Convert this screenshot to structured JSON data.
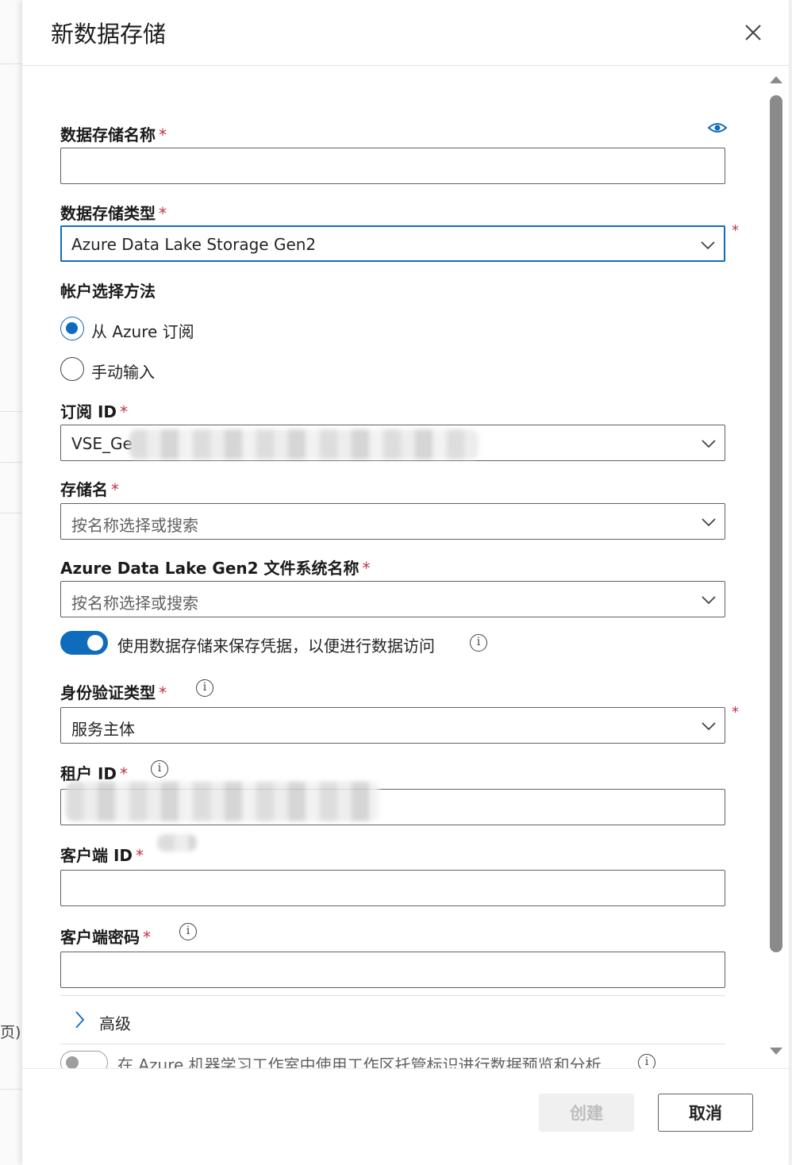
{
  "background": {
    "cut_text": "页)"
  },
  "panel": {
    "title": "新数据存储"
  },
  "form": {
    "datastore_name": {
      "label": "数据存储名称",
      "required": "*",
      "value": ""
    },
    "datastore_type": {
      "label": "数据存储类型",
      "required": "*",
      "value": "Azure Data Lake Storage Gen2",
      "outer_required": "*"
    },
    "account_method": {
      "label": "帐户选择方法",
      "options": [
        {
          "label": "从 Azure 订阅",
          "selected": true
        },
        {
          "label": "手动输入",
          "selected": false
        }
      ]
    },
    "subscription_id": {
      "label": "订阅 ID",
      "required": "*",
      "value": "VSE_Ge"
    },
    "storage_name": {
      "label": "存储名",
      "required": "*",
      "placeholder": "按名称选择或搜索"
    },
    "filesystem_name": {
      "label": "Azure Data Lake Gen2 文件系统名称",
      "required": "*",
      "placeholder": "按名称选择或搜索"
    },
    "save_credentials": {
      "label": "使用数据存储来保存凭据，以便进行数据访问",
      "on": true
    },
    "auth_type": {
      "label": "身份验证类型",
      "required": "*",
      "value": "服务主体",
      "outer_required": "*"
    },
    "tenant_id": {
      "label": "租户 ID",
      "required": "*",
      "value": ""
    },
    "client_id": {
      "label": "客户端 ID",
      "required": "*",
      "value": ""
    },
    "client_secret": {
      "label": "客户端密码",
      "required": "*",
      "value": ""
    },
    "advanced": {
      "label": "高级"
    },
    "managed_identity": {
      "label": "在 Azure 机器学习工作室中使用工作区托管标识进行数据预览和分析",
      "on": false
    }
  },
  "footer": {
    "create_label": "创建",
    "cancel_label": "取消"
  },
  "icons": {
    "close": "close-icon",
    "eye": "eye-icon",
    "chevron": "chevron-down-icon",
    "info": "info-icon",
    "expand": "chevron-right-icon"
  },
  "colors": {
    "accent": "#0f6cbd",
    "required": "#c4314b",
    "border": "#616161"
  }
}
